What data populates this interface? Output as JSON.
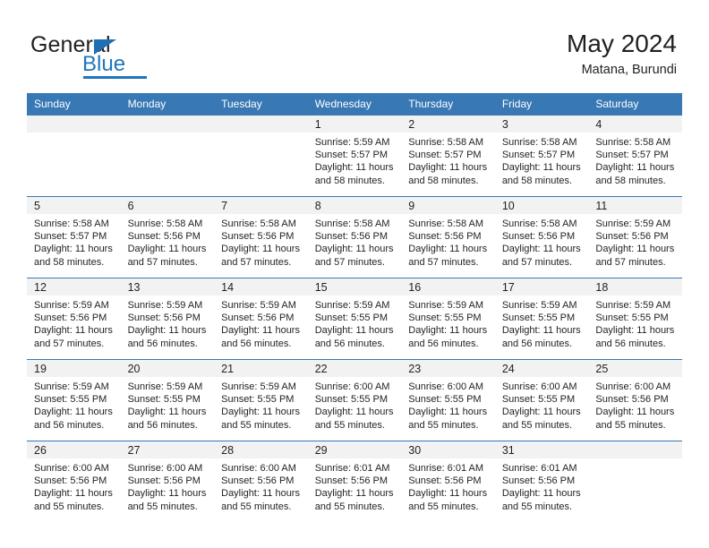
{
  "brand": {
    "name_top": "General",
    "name_bottom": "Blue",
    "accent_color": "#1f76bc",
    "header_color": "#3878b4"
  },
  "header": {
    "title": "May 2024",
    "subtitle": "Matana, Burundi"
  },
  "calendar": {
    "weekday_headers": [
      "Sunday",
      "Monday",
      "Tuesday",
      "Wednesday",
      "Thursday",
      "Friday",
      "Saturday"
    ],
    "weeks": [
      [
        {
          "day": "",
          "sunrise": "",
          "sunset": "",
          "daylight_line1": "",
          "daylight_line2": ""
        },
        {
          "day": "",
          "sunrise": "",
          "sunset": "",
          "daylight_line1": "",
          "daylight_line2": ""
        },
        {
          "day": "",
          "sunrise": "",
          "sunset": "",
          "daylight_line1": "",
          "daylight_line2": ""
        },
        {
          "day": "1",
          "sunrise": "Sunrise: 5:59 AM",
          "sunset": "Sunset: 5:57 PM",
          "daylight_line1": "Daylight: 11 hours",
          "daylight_line2": "and 58 minutes."
        },
        {
          "day": "2",
          "sunrise": "Sunrise: 5:58 AM",
          "sunset": "Sunset: 5:57 PM",
          "daylight_line1": "Daylight: 11 hours",
          "daylight_line2": "and 58 minutes."
        },
        {
          "day": "3",
          "sunrise": "Sunrise: 5:58 AM",
          "sunset": "Sunset: 5:57 PM",
          "daylight_line1": "Daylight: 11 hours",
          "daylight_line2": "and 58 minutes."
        },
        {
          "day": "4",
          "sunrise": "Sunrise: 5:58 AM",
          "sunset": "Sunset: 5:57 PM",
          "daylight_line1": "Daylight: 11 hours",
          "daylight_line2": "and 58 minutes."
        }
      ],
      [
        {
          "day": "5",
          "sunrise": "Sunrise: 5:58 AM",
          "sunset": "Sunset: 5:57 PM",
          "daylight_line1": "Daylight: 11 hours",
          "daylight_line2": "and 58 minutes."
        },
        {
          "day": "6",
          "sunrise": "Sunrise: 5:58 AM",
          "sunset": "Sunset: 5:56 PM",
          "daylight_line1": "Daylight: 11 hours",
          "daylight_line2": "and 57 minutes."
        },
        {
          "day": "7",
          "sunrise": "Sunrise: 5:58 AM",
          "sunset": "Sunset: 5:56 PM",
          "daylight_line1": "Daylight: 11 hours",
          "daylight_line2": "and 57 minutes."
        },
        {
          "day": "8",
          "sunrise": "Sunrise: 5:58 AM",
          "sunset": "Sunset: 5:56 PM",
          "daylight_line1": "Daylight: 11 hours",
          "daylight_line2": "and 57 minutes."
        },
        {
          "day": "9",
          "sunrise": "Sunrise: 5:58 AM",
          "sunset": "Sunset: 5:56 PM",
          "daylight_line1": "Daylight: 11 hours",
          "daylight_line2": "and 57 minutes."
        },
        {
          "day": "10",
          "sunrise": "Sunrise: 5:58 AM",
          "sunset": "Sunset: 5:56 PM",
          "daylight_line1": "Daylight: 11 hours",
          "daylight_line2": "and 57 minutes."
        },
        {
          "day": "11",
          "sunrise": "Sunrise: 5:59 AM",
          "sunset": "Sunset: 5:56 PM",
          "daylight_line1": "Daylight: 11 hours",
          "daylight_line2": "and 57 minutes."
        }
      ],
      [
        {
          "day": "12",
          "sunrise": "Sunrise: 5:59 AM",
          "sunset": "Sunset: 5:56 PM",
          "daylight_line1": "Daylight: 11 hours",
          "daylight_line2": "and 57 minutes."
        },
        {
          "day": "13",
          "sunrise": "Sunrise: 5:59 AM",
          "sunset": "Sunset: 5:56 PM",
          "daylight_line1": "Daylight: 11 hours",
          "daylight_line2": "and 56 minutes."
        },
        {
          "day": "14",
          "sunrise": "Sunrise: 5:59 AM",
          "sunset": "Sunset: 5:56 PM",
          "daylight_line1": "Daylight: 11 hours",
          "daylight_line2": "and 56 minutes."
        },
        {
          "day": "15",
          "sunrise": "Sunrise: 5:59 AM",
          "sunset": "Sunset: 5:55 PM",
          "daylight_line1": "Daylight: 11 hours",
          "daylight_line2": "and 56 minutes."
        },
        {
          "day": "16",
          "sunrise": "Sunrise: 5:59 AM",
          "sunset": "Sunset: 5:55 PM",
          "daylight_line1": "Daylight: 11 hours",
          "daylight_line2": "and 56 minutes."
        },
        {
          "day": "17",
          "sunrise": "Sunrise: 5:59 AM",
          "sunset": "Sunset: 5:55 PM",
          "daylight_line1": "Daylight: 11 hours",
          "daylight_line2": "and 56 minutes."
        },
        {
          "day": "18",
          "sunrise": "Sunrise: 5:59 AM",
          "sunset": "Sunset: 5:55 PM",
          "daylight_line1": "Daylight: 11 hours",
          "daylight_line2": "and 56 minutes."
        }
      ],
      [
        {
          "day": "19",
          "sunrise": "Sunrise: 5:59 AM",
          "sunset": "Sunset: 5:55 PM",
          "daylight_line1": "Daylight: 11 hours",
          "daylight_line2": "and 56 minutes."
        },
        {
          "day": "20",
          "sunrise": "Sunrise: 5:59 AM",
          "sunset": "Sunset: 5:55 PM",
          "daylight_line1": "Daylight: 11 hours",
          "daylight_line2": "and 56 minutes."
        },
        {
          "day": "21",
          "sunrise": "Sunrise: 5:59 AM",
          "sunset": "Sunset: 5:55 PM",
          "daylight_line1": "Daylight: 11 hours",
          "daylight_line2": "and 55 minutes."
        },
        {
          "day": "22",
          "sunrise": "Sunrise: 6:00 AM",
          "sunset": "Sunset: 5:55 PM",
          "daylight_line1": "Daylight: 11 hours",
          "daylight_line2": "and 55 minutes."
        },
        {
          "day": "23",
          "sunrise": "Sunrise: 6:00 AM",
          "sunset": "Sunset: 5:55 PM",
          "daylight_line1": "Daylight: 11 hours",
          "daylight_line2": "and 55 minutes."
        },
        {
          "day": "24",
          "sunrise": "Sunrise: 6:00 AM",
          "sunset": "Sunset: 5:55 PM",
          "daylight_line1": "Daylight: 11 hours",
          "daylight_line2": "and 55 minutes."
        },
        {
          "day": "25",
          "sunrise": "Sunrise: 6:00 AM",
          "sunset": "Sunset: 5:56 PM",
          "daylight_line1": "Daylight: 11 hours",
          "daylight_line2": "and 55 minutes."
        }
      ],
      [
        {
          "day": "26",
          "sunrise": "Sunrise: 6:00 AM",
          "sunset": "Sunset: 5:56 PM",
          "daylight_line1": "Daylight: 11 hours",
          "daylight_line2": "and 55 minutes."
        },
        {
          "day": "27",
          "sunrise": "Sunrise: 6:00 AM",
          "sunset": "Sunset: 5:56 PM",
          "daylight_line1": "Daylight: 11 hours",
          "daylight_line2": "and 55 minutes."
        },
        {
          "day": "28",
          "sunrise": "Sunrise: 6:00 AM",
          "sunset": "Sunset: 5:56 PM",
          "daylight_line1": "Daylight: 11 hours",
          "daylight_line2": "and 55 minutes."
        },
        {
          "day": "29",
          "sunrise": "Sunrise: 6:01 AM",
          "sunset": "Sunset: 5:56 PM",
          "daylight_line1": "Daylight: 11 hours",
          "daylight_line2": "and 55 minutes."
        },
        {
          "day": "30",
          "sunrise": "Sunrise: 6:01 AM",
          "sunset": "Sunset: 5:56 PM",
          "daylight_line1": "Daylight: 11 hours",
          "daylight_line2": "and 55 minutes."
        },
        {
          "day": "31",
          "sunrise": "Sunrise: 6:01 AM",
          "sunset": "Sunset: 5:56 PM",
          "daylight_line1": "Daylight: 11 hours",
          "daylight_line2": "and 55 minutes."
        },
        {
          "day": "",
          "sunrise": "",
          "sunset": "",
          "daylight_line1": "",
          "daylight_line2": ""
        }
      ]
    ]
  }
}
